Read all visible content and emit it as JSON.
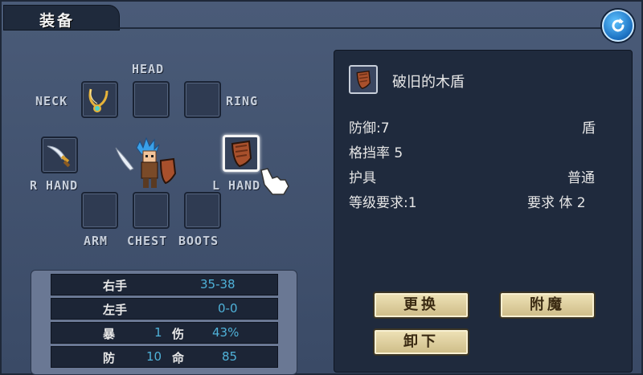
{
  "window": {
    "title": "装备"
  },
  "icons": {
    "back": "refresh-arrow-icon",
    "neck_item": "necklace-icon",
    "rhand_item": "sword-icon",
    "lhand_item": "wooden-shield-icon",
    "cursor": "hand-pointer-icon"
  },
  "slots": {
    "head": "HEAD",
    "neck": "NECK",
    "ring": "RING",
    "r_hand": "R HAND",
    "l_hand": "L HAND",
    "arm": "ARM",
    "chest": "CHEST",
    "boots": "BOOTS"
  },
  "stats": {
    "right_hand_label": "右手",
    "right_hand_value": "35-38",
    "left_hand_label": "左手",
    "left_hand_value": "0-0",
    "crit_label": "暴",
    "crit_value": "1",
    "dmg_label": "伤",
    "dmg_value": "43%",
    "def_label": "防",
    "def_value": "10",
    "hit_label": "命",
    "hit_value": "85"
  },
  "item": {
    "name": "破旧的木盾",
    "defense": "防御:7",
    "type": "盾",
    "block": "格挡率 5",
    "category": "护具",
    "quality": "普通",
    "level_req": "等级要求:1",
    "attr_req": "要求 体 2"
  },
  "buttons": {
    "replace": "更换",
    "enchant": "附魔",
    "unequip": "卸下"
  },
  "colors": {
    "stat_value": "#4fb2d9",
    "button_bg": "#e6d8a8",
    "panel_dark": "#1f2a3d"
  }
}
